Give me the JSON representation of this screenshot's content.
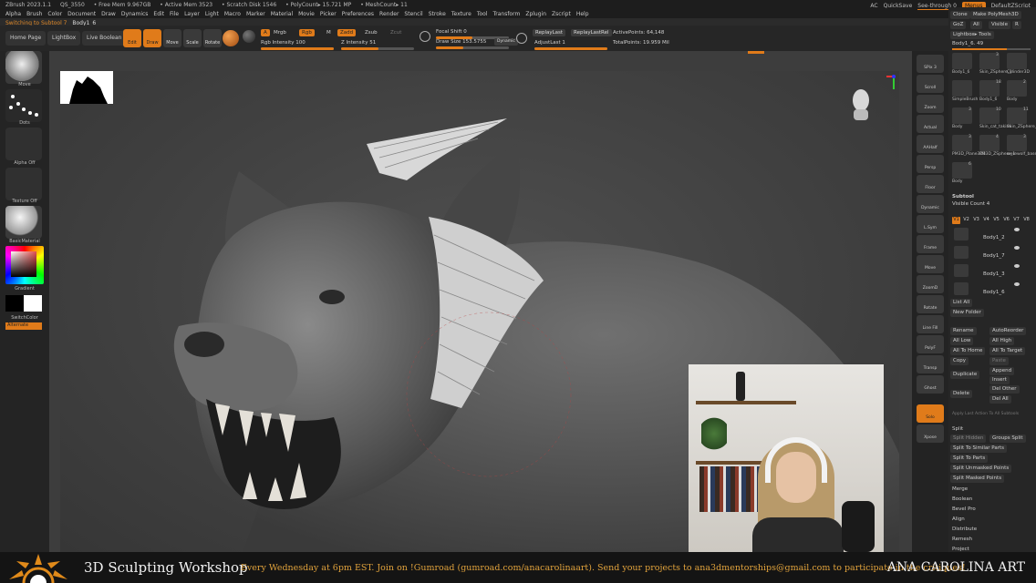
{
  "menubar": {
    "app": "ZBrush 2023.1.1",
    "qs": "QS_3550",
    "free_mem": "• Free Mem 9.967GB",
    "active_mem": "• Active Mem 3523",
    "scratch_disk": "• Scratch Disk 1546",
    "poly_count": "• PolyCount▸ 15.721 MP",
    "mesh_count": "• MeshCount▸ 11",
    "menus": [
      "Alpha",
      "Brush",
      "Color",
      "Document",
      "Draw",
      "Dynamics",
      "Edit",
      "File",
      "Layer",
      "Light",
      "Macro",
      "Marker",
      "Material",
      "Movie",
      "Picker",
      "Preferences",
      "Render",
      "Stencil",
      "Stroke",
      "Texture",
      "Tool",
      "Transform",
      "Zplugin",
      "Zscript",
      "Help"
    ],
    "ac": "AC",
    "quicksave": "QuickSave",
    "see_through": "See-through  0",
    "menus_btn": "Menus",
    "default_script": "DefaultZScript"
  },
  "status": {
    "switching": "Switching to Subtool 7",
    "name": "Body1_6"
  },
  "toolbar": {
    "home_page": "Home Page",
    "lightbox": "LightBox",
    "live_boolean": "Live Boolean",
    "edit": "Edit",
    "draw": "Draw",
    "move": "Move",
    "scale": "Scale",
    "rotate": "Rotate",
    "a": "A",
    "mrgb": "Mrgb",
    "rgb": "Rgb",
    "m": "M",
    "zadd": "Zadd",
    "zsub": "Zsub",
    "zcut": "Zcut",
    "rgb_intensity": "Rgb Intensity 100",
    "z_intensity": "Z Intensity 51",
    "focal_shift": "Focal Shift 0",
    "draw_size": "Draw Size 153.5755",
    "dynamic": "Dynamic",
    "replay_last": "ReplayLast",
    "replay_last_rel": "ReplayLastRel",
    "adjust_last": "AdjustLast  1",
    "active_points": "ActivePoints: 64,148",
    "total_points": "TotalPoints: 19.959 Mil"
  },
  "leftshelf": {
    "move": "Move",
    "dots": "Dots",
    "alpha_off": "Alpha Off",
    "texture_off": "Texture Off",
    "basic_material": "BasicMaterial",
    "gradient": "Gradient",
    "switch_color": "SwitchColor",
    "alternate": "Alternate"
  },
  "rightshelf": [
    "SPix 3",
    "Scroll",
    "Zoom",
    "Actual",
    "AAHalf",
    "Persp",
    "Floor",
    "Dynamic",
    "L.Sym",
    "Frame",
    "Move",
    "ZoomD",
    "Rotate",
    "Line Fill",
    "PolyF",
    "Transp",
    "Ghost",
    "Solo",
    "Xpose"
  ],
  "panel": {
    "clone": "Clone",
    "make_polymesh": "Make PolyMesh3D",
    "goz": "GoZ",
    "all": "All",
    "visible": "Visible",
    "r": "R",
    "lightbox_tools": "Lightbox▸ Tools",
    "body_value": "Body1_6. 49",
    "tools": [
      {
        "label": "Body1_6",
        "count": ""
      },
      {
        "label": "Skin_ZSphere_1",
        "count": "3"
      },
      {
        "label": "Cylinder3D",
        "count": ""
      },
      {
        "label": "SimpleBrush",
        "count": ""
      },
      {
        "label": "Body1_6",
        "count": "18"
      },
      {
        "label": "Body",
        "count": "2"
      },
      {
        "label": "Body",
        "count": "3"
      },
      {
        "label": "Skin_cat_takimi",
        "count": "10"
      },
      {
        "label": "Skin_ZSphere_3",
        "count": "11"
      },
      {
        "label": "PM3D_Plane3D1",
        "count": "3"
      },
      {
        "label": "PM3D_ZSphere_1",
        "count": "4"
      },
      {
        "label": "werewolf_bases",
        "count": "3"
      },
      {
        "label": "Body",
        "count": "6"
      }
    ],
    "subtool": "Subtool",
    "visible_count": "Visible Count 4",
    "tabs": [
      "V1",
      "V2",
      "V3",
      "V4",
      "V5",
      "V6",
      "V7",
      "V8"
    ],
    "subtools": [
      "Body1_2",
      "Body1_7",
      "Body1_3",
      "Body1_6"
    ],
    "list_all": "List All",
    "new_folder": "New Folder",
    "rename": "Rename",
    "auto_reorder": "AutoReorder",
    "all_low": "All Low",
    "all_high": "All High",
    "all_to_home": "All To Home",
    "all_to_target": "All To Target",
    "copy": "Copy",
    "paste": "Paste",
    "duplicate": "Duplicate",
    "append": "Append",
    "insert": "Insert",
    "delete": "Delete",
    "del_other": "Del Other",
    "del_all": "Del All",
    "apply_last_action": "Apply Last Action To All Subtools",
    "split": "Split",
    "split_hidden": "Split Hidden",
    "groups_split": "Groups Split",
    "split_similar": "Split To Similar Parts",
    "split_parts": "Split To Parts",
    "split_unmasked": "Split Unmasked Points",
    "split_masked": "Split Masked Points",
    "merge": "Merge",
    "boolean": "Boolean",
    "bevel_pro": "Bevel Pro",
    "align": "Align",
    "distribute": "Distribute",
    "remesh": "Remesh",
    "project": "Project"
  },
  "banner": {
    "title": "3D Sculpting Workshop",
    "description": "Every Wednesday at 6pm EST. Join on !Gumroad (gumroad.com/anacarolinaart). Send your projects to ana3dmentorships@gmail.com to participate in the critiques!",
    "brand": "ANA CAROLINA ART"
  },
  "colors": {
    "accent": "#e07b1a",
    "background": "#2b2b2b",
    "viewport": "#3d3d3d"
  }
}
